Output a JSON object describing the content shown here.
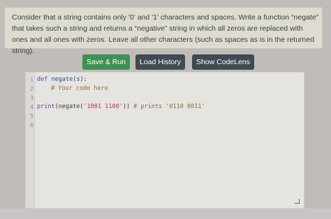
{
  "prompt": {
    "text": "Consider that a string contains only '0' and '1' characters and spaces. Write a function “negate” that takes such a string and returns a “negative” string in which all zeros are replaced with ones and all ones with zeros. Leave all other characters (such as spaces as is in the returned string)."
  },
  "toolbar": {
    "run_label": "Save & Run",
    "history_label": "Load History",
    "codelens_label": "Show CodeLens"
  },
  "editor": {
    "line_numbers": [
      "1",
      "2",
      "3",
      "4",
      "5",
      "6"
    ],
    "lines": {
      "l1_kw": "def",
      "l1_fn": "negate",
      "l1_rest": "(s):",
      "l2_comment": "# Your code here",
      "l4_kw": "print",
      "l4_a": "(negate(",
      "l4_str": "'1001 1100'",
      "l4_b": ")) ",
      "l4_comment": "# prints '0110 0011'"
    }
  },
  "colors": {
    "run_button": "#3f9153",
    "secondary_button": "#3f4a52",
    "prompt_background": "#dedbd0",
    "editor_background": "#e6e4e1"
  }
}
